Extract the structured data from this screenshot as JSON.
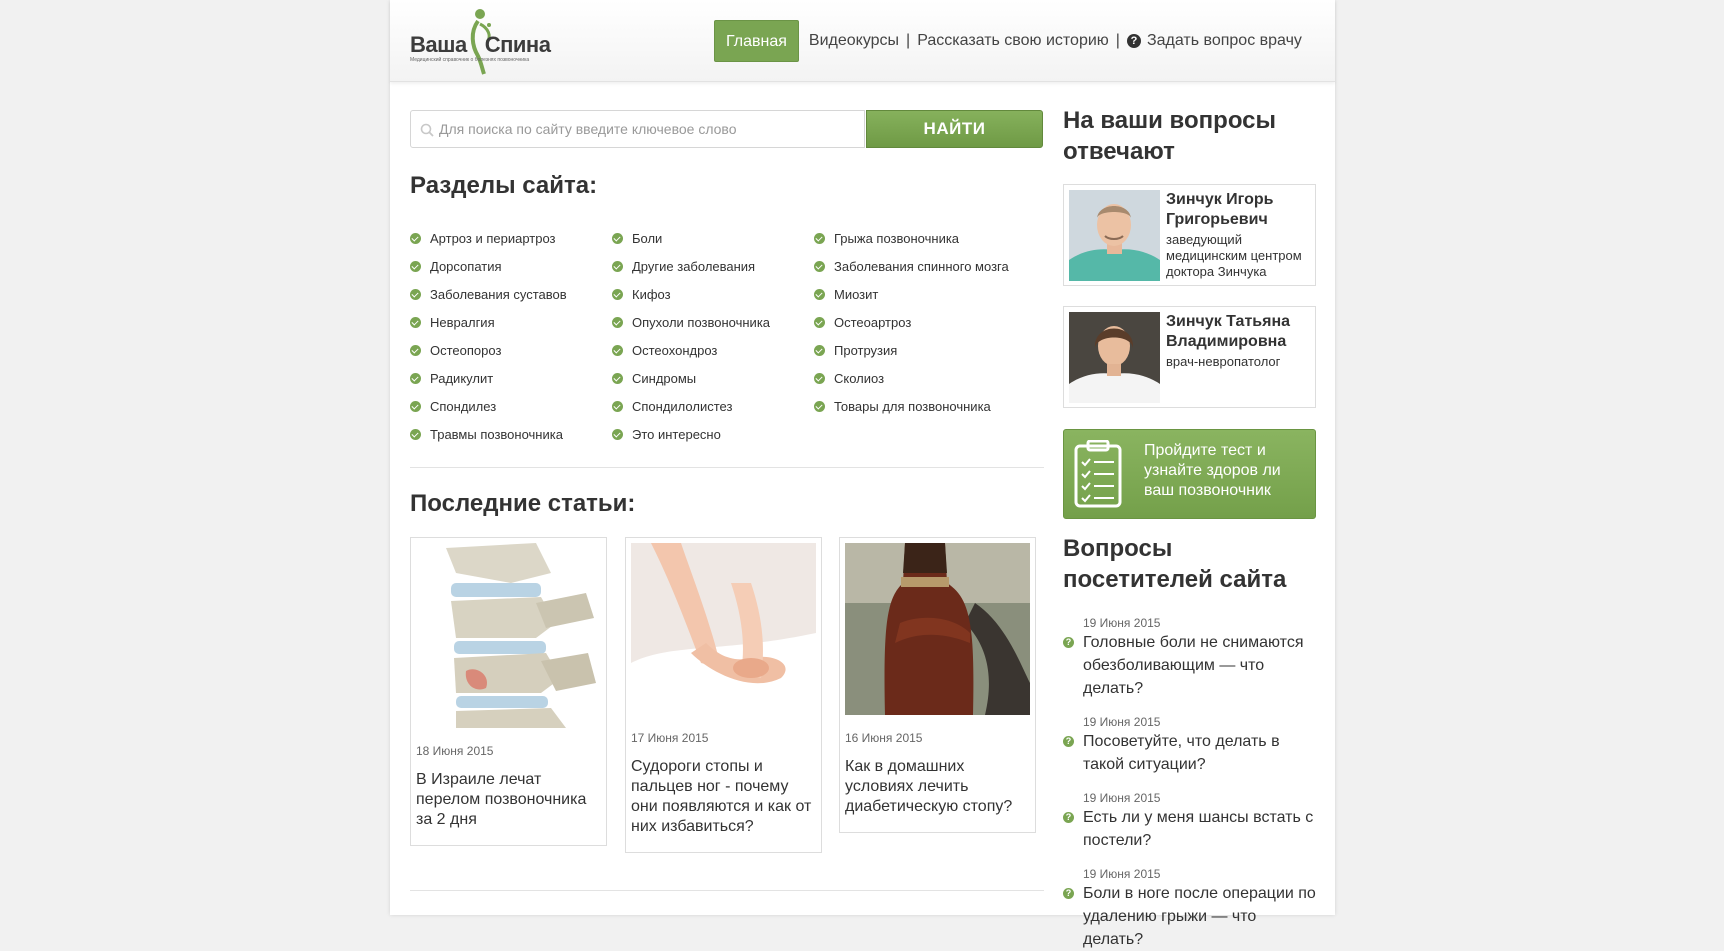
{
  "header": {
    "logo_word1": "Ваша",
    "logo_word2": "Спина",
    "logo_tagline": "Медицинский справочник о болезнях позвоночника",
    "nav": {
      "home": "Главная",
      "videocourses": "Видеокурсы",
      "separator": "|",
      "tell_story": "Рассказать свою историю",
      "ask_doctor": "Задать вопрос врачу"
    }
  },
  "search": {
    "placeholder": "Для поиска по сайту введите ключевое слово",
    "button": "НАЙТИ"
  },
  "sections": {
    "title": "Разделы сайта:",
    "items": [
      "Артроз и периартроз",
      "Боли",
      "Грыжа позвоночника",
      "Дорсопатия",
      "Другие заболевания",
      "Заболевания спинного мозга",
      "Заболевания суставов",
      "Кифоз",
      "Миозит",
      "Невралгия",
      "Опухоли позвоночника",
      "Остеоартроз",
      "Остеопороз",
      "Остеохондроз",
      "Протрузия",
      "Радикулит",
      "Синдромы",
      "Сколиоз",
      "Спондилез",
      "Спондилолистез",
      "Товары для позвоночника",
      "Травмы позвоночника",
      "Это интересно"
    ]
  },
  "articles": {
    "title": "Последние статьи:",
    "items": [
      {
        "date": "18 Июня 2015",
        "title": "В Израиле лечат перелом позвоночника за 2 дня"
      },
      {
        "date": "17 Июня 2015",
        "title": "Судороги стопы и пальцев ног - почему они появляются и как от них избавиться?"
      },
      {
        "date": "16 Июня 2015",
        "title": "Как в домашних условиях лечить диабетическую стопу?"
      }
    ]
  },
  "sidebar": {
    "experts_title": "На ваши вопросы отвечают",
    "doctors": [
      {
        "name": "Зинчук Игорь Григорьевич",
        "role": "заведующий медицинским центром доктора Зинчука"
      },
      {
        "name": "Зинчук Татьяна Владимировна",
        "role": "врач-невропатолог"
      }
    ],
    "test_banner": "Пройдите тест и узнайте здоров ли ваш позвоночник",
    "questions_title": "Вопросы посетителей сайта",
    "questions": [
      {
        "date": "19 Июня 2015",
        "text": "Головные боли не снимаются обезболивающим — что делать?"
      },
      {
        "date": "19 Июня 2015",
        "text": "Посоветуйте, что делать в такой ситуации?"
      },
      {
        "date": "19 Июня 2015",
        "text": "Есть ли у меня шансы встать с постели?"
      },
      {
        "date": "19 Июня 2015",
        "text": "Боли в ноге после операции по удалению грыжи — что делать?"
      }
    ]
  },
  "colors": {
    "accent": "#7aa552",
    "background": "#f1f1f1"
  }
}
